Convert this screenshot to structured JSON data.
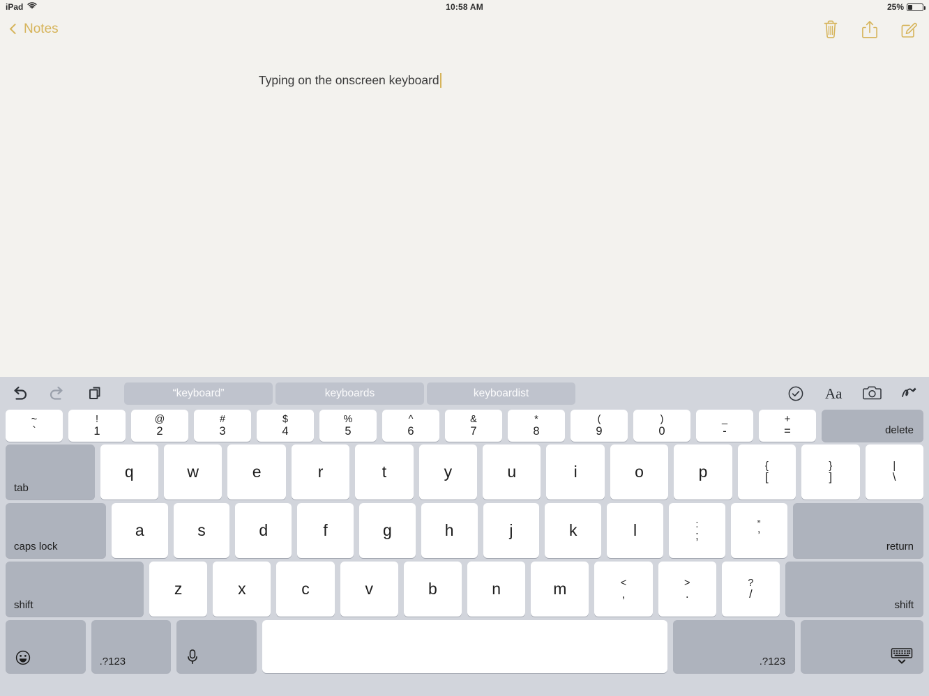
{
  "status_bar": {
    "device": "iPad",
    "wifi_icon": "wifi-icon",
    "time": "10:58 AM",
    "battery_percent": "25%",
    "battery_level": 25
  },
  "nav_bar": {
    "back_label": "Notes",
    "back_icon": "chevron-left-icon",
    "actions": [
      {
        "name": "trash-icon",
        "label": "Delete"
      },
      {
        "name": "share-icon",
        "label": "Share"
      },
      {
        "name": "compose-icon",
        "label": "New Note"
      }
    ],
    "accent_color": "#d6b45a"
  },
  "note": {
    "text": "Typing on the onscreen keyboard",
    "caret_color": "#d6b45a",
    "background": "#f3f2ee"
  },
  "keyboard": {
    "background": "#d2d5dc",
    "key_color": "#ffffff",
    "modifier_key_color": "#aeb3bd",
    "toolbar": {
      "left_icons": [
        {
          "name": "undo-icon",
          "enabled": true
        },
        {
          "name": "redo-icon",
          "enabled": false
        },
        {
          "name": "paste-icon",
          "enabled": true
        }
      ],
      "suggestions": [
        "“keyboard”",
        "keyboards",
        "keyboardist"
      ],
      "right_icons": [
        {
          "name": "checklist-icon"
        },
        {
          "name": "text-format-icon",
          "label": "Aa"
        },
        {
          "name": "camera-icon"
        },
        {
          "name": "markup-squiggle-icon"
        }
      ]
    },
    "rows": {
      "numbers": [
        {
          "top": "~",
          "bot": "`"
        },
        {
          "top": "!",
          "bot": "1"
        },
        {
          "top": "@",
          "bot": "2"
        },
        {
          "top": "#",
          "bot": "3"
        },
        {
          "top": "$",
          "bot": "4"
        },
        {
          "top": "%",
          "bot": "5"
        },
        {
          "top": "^",
          "bot": "6"
        },
        {
          "top": "&",
          "bot": "7"
        },
        {
          "top": "*",
          "bot": "8"
        },
        {
          "top": "(",
          "bot": "9"
        },
        {
          "top": ")",
          "bot": "0"
        },
        {
          "top": "_",
          "bot": "-"
        },
        {
          "top": "+",
          "bot": "="
        }
      ],
      "delete_label": "delete",
      "tab_label": "tab",
      "qwerty": [
        "q",
        "w",
        "e",
        "r",
        "t",
        "y",
        "u",
        "i",
        "o",
        "p"
      ],
      "qwerty_symbols": [
        {
          "top": "{",
          "bot": "["
        },
        {
          "top": "}",
          "bot": "]"
        },
        {
          "top": "|",
          "bot": "\\"
        }
      ],
      "caps_lock_label": "caps lock",
      "home": [
        "a",
        "s",
        "d",
        "f",
        "g",
        "h",
        "j",
        "k",
        "l"
      ],
      "home_symbols": [
        {
          "top": ":",
          "bot": ";"
        },
        {
          "top": "”",
          "bot": "’"
        }
      ],
      "return_label": "return",
      "shift_left_label": "shift",
      "shift_right_label": "shift",
      "zxcv": [
        "z",
        "x",
        "c",
        "v",
        "b",
        "n",
        "m"
      ],
      "zxcv_symbols": [
        {
          "top": "<",
          "bot": ","
        },
        {
          "top": ">",
          "bot": "."
        },
        {
          "top": "?",
          "bot": "/"
        }
      ],
      "bottom": {
        "emoji_icon": "emoji-smiley-icon",
        "numeric_left_label": ".?123",
        "dictation_icon": "microphone-icon",
        "space_label": "",
        "numeric_right_label": ".?123",
        "hide_keyboard_icon": "hide-keyboard-icon"
      }
    }
  }
}
